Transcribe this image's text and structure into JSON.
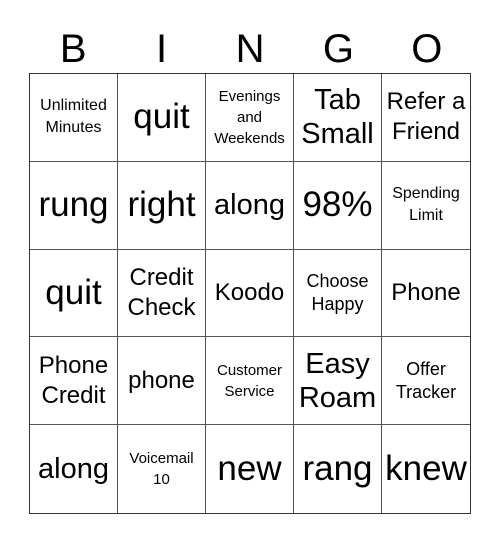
{
  "header": {
    "letters": [
      "B",
      "I",
      "N",
      "G",
      "O"
    ]
  },
  "card": {
    "rows": [
      [
        {
          "text": "Unlimited Minutes",
          "size": "s-xs"
        },
        {
          "text": "quit",
          "size": "s-xl"
        },
        {
          "text": "Evenings and Weekends",
          "size": "s-xxs"
        },
        {
          "text": "Tab Small",
          "size": "s-lg"
        },
        {
          "text": "Refer a Friend",
          "size": "s-md"
        }
      ],
      [
        {
          "text": "rung",
          "size": "s-xl"
        },
        {
          "text": "right",
          "size": "s-xl"
        },
        {
          "text": "along",
          "size": "s-lg"
        },
        {
          "text": "98%",
          "size": "s-xl"
        },
        {
          "text": "Spending Limit",
          "size": "s-xs"
        }
      ],
      [
        {
          "text": "quit",
          "size": "s-xl"
        },
        {
          "text": "Credit Check",
          "size": "s-md"
        },
        {
          "text": "Koodo",
          "size": "s-md"
        },
        {
          "text": "Choose Happy",
          "size": "s-sm"
        },
        {
          "text": "Phone",
          "size": "s-md"
        }
      ],
      [
        {
          "text": "Phone Credit",
          "size": "s-md"
        },
        {
          "text": "phone",
          "size": "s-md"
        },
        {
          "text": "Customer Service",
          "size": "s-xxs"
        },
        {
          "text": "Easy Roam",
          "size": "s-lg"
        },
        {
          "text": "Offer Tracker",
          "size": "s-sm"
        }
      ],
      [
        {
          "text": "along",
          "size": "s-lg"
        },
        {
          "text": "Voicemail 10",
          "size": "s-xxs"
        },
        {
          "text": "new",
          "size": "s-xl"
        },
        {
          "text": "rang",
          "size": "s-xl"
        },
        {
          "text": "knew",
          "size": "s-xl"
        }
      ]
    ]
  }
}
